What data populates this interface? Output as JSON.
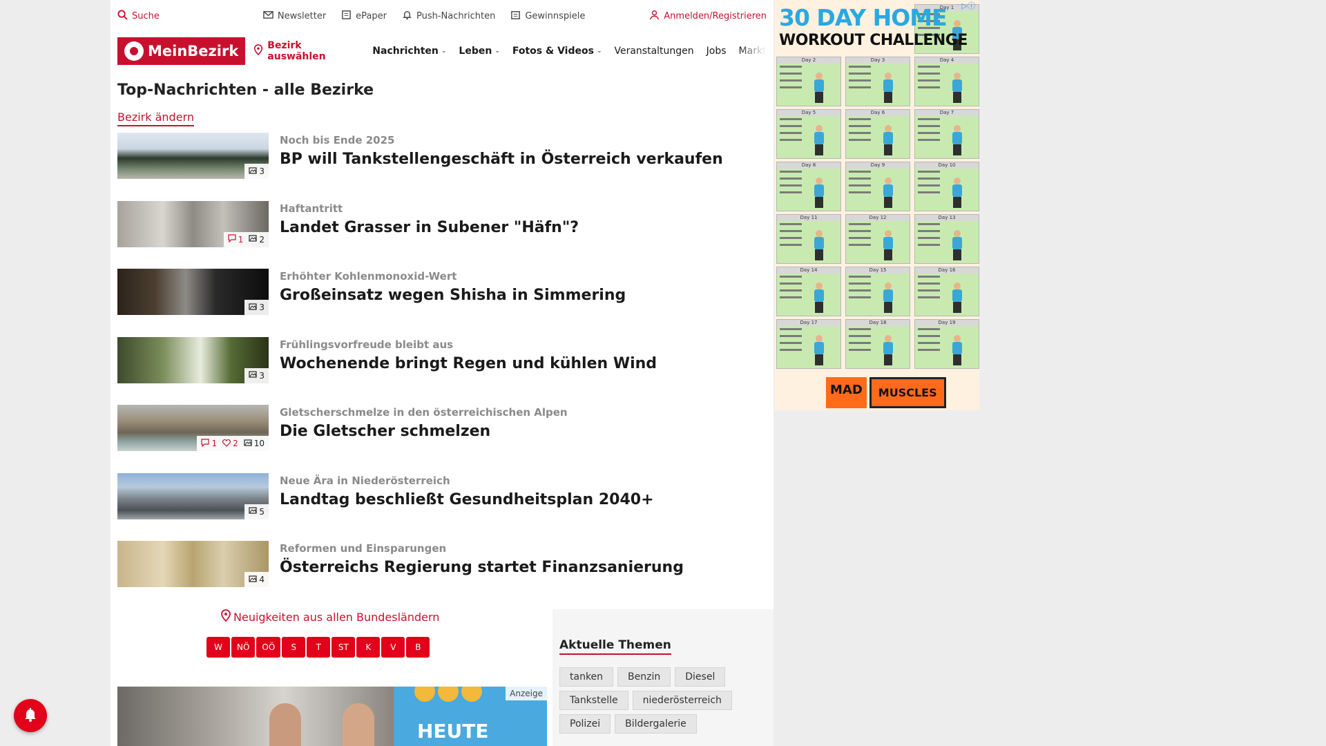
{
  "util": {
    "search": "Suche",
    "newsletter": "Newsletter",
    "epaper": "ePaper",
    "push": "Push-Nachrichten",
    "gewinnspiele": "Gewinnspiele",
    "login": "Anmelden/Registrieren"
  },
  "nav": {
    "logo": "MeinBezirk",
    "bezirk": "Bezirk auswählen",
    "items": [
      {
        "label": "Nachrichten",
        "bold": true,
        "chevron": true
      },
      {
        "label": "Leben",
        "bold": true,
        "chevron": true
      },
      {
        "label": "Fotos & Videos",
        "bold": true,
        "chevron": true
      },
      {
        "label": "Veranstaltungen",
        "bold": false,
        "chevron": false
      },
      {
        "label": "Jobs",
        "bold": false,
        "chevron": false
      },
      {
        "label": "Marktplatz",
        "bold": false,
        "chevron": false
      }
    ]
  },
  "main": {
    "title": "Top-Nachrichten - alle Bezirke",
    "change_bezirk": "Bezirk ändern",
    "news": [
      {
        "kicker": "Noch bis Ende 2025",
        "headline": "BP will Tankstellengeschäft in Österreich verkaufen",
        "comments": "",
        "likes": "",
        "images": "3",
        "img": "station"
      },
      {
        "kicker": "Haftantritt",
        "headline": "Landet Grasser in Subener \"Häfn\"?",
        "comments": "1",
        "likes": "",
        "images": "2",
        "img": "corridor"
      },
      {
        "kicker": "Erhöhter Kohlenmonoxid-Wert",
        "headline": "Großeinsatz wegen Shisha in Simmering",
        "comments": "",
        "likes": "",
        "images": "3",
        "img": "smoke"
      },
      {
        "kicker": "Frühlingsvorfreude bleibt aus",
        "headline": "Wochenende bringt Regen und kühlen Wind",
        "comments": "",
        "likes": "",
        "images": "3",
        "img": "flower"
      },
      {
        "kicker": "Gletscherschmelze in den österreichischen Alpen",
        "headline": "Die Gletscher schmelzen",
        "comments": "1",
        "likes": "2",
        "images": "10",
        "img": "glacier"
      },
      {
        "kicker": "Neue Ära in Niederösterreich",
        "headline": "Landtag beschließt Gesundheitsplan 2040+",
        "comments": "",
        "likes": "",
        "images": "5",
        "img": "building"
      },
      {
        "kicker": "Reformen und Einsparungen",
        "headline": "Österreichs Regierung startet Finanzsanierung",
        "comments": "",
        "likes": "",
        "images": "4",
        "img": "money"
      }
    ]
  },
  "states": {
    "link": "Neuigkeiten aus allen Bundesländern",
    "buttons": [
      "W",
      "NÖ",
      "OÖ",
      "S",
      "T",
      "ST",
      "K",
      "V",
      "B"
    ]
  },
  "ad_card": {
    "label": "Anzeige",
    "banner_text": "HEUTE"
  },
  "topics": {
    "title": "Aktuelle Themen",
    "tags": [
      "tanken",
      "Benzin",
      "Diesel",
      "Tankstelle",
      "niederösterreich",
      "Polizei",
      "Bildergalerie"
    ]
  },
  "sky_ad": {
    "title1": "30 DAY HOME",
    "title2": "WORKOUT CHALLENGE",
    "days": [
      "Day 1",
      "Day 2",
      "Day 3",
      "Day 4",
      "Day 5",
      "Day 6",
      "Day 7",
      "Day 8",
      "Day 9",
      "Day 10",
      "Day 11",
      "Day 12",
      "Day 13",
      "Day 14",
      "Day 15",
      "Day 16",
      "Day 17",
      "Day 18",
      "Day 19"
    ],
    "brand1": "MAD",
    "brand2": "MUSCLES"
  },
  "colors": {
    "accent": "#c8102e",
    "state_button": "#e2001a"
  }
}
